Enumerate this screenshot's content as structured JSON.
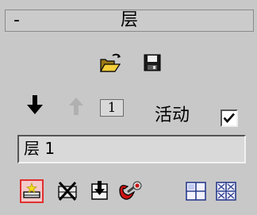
{
  "rollout": {
    "collapse_symbol": "-",
    "title": "层"
  },
  "file_buttons": [
    {
      "icon": "open-folder-icon"
    },
    {
      "icon": "save-disk-icon"
    }
  ],
  "layer_controls": {
    "move_down_icon": "arrow-down-icon",
    "move_up_icon": "arrow-up-icon",
    "counter_value": "1",
    "active_label": "活动",
    "active_checked": true
  },
  "layer_name": "层 1",
  "toolbar": [
    {
      "icon": "new-layer-icon",
      "selected": true
    },
    {
      "icon": "delete-layer-icon",
      "selected": false
    },
    {
      "icon": "merge-down-icon",
      "selected": false
    },
    {
      "icon": "pick-object-icon",
      "selected": false
    },
    {
      "icon": "select-objects-icon",
      "selected": false
    },
    {
      "icon": "select-all-icon",
      "selected": false
    }
  ],
  "colors": {
    "panel_bg": "#c8c8c8",
    "selected_border": "#e03030",
    "selected_fill": "#f3caca",
    "arrow_disabled": "#b0b0b0",
    "tool_blue": "#2a3c8c"
  }
}
